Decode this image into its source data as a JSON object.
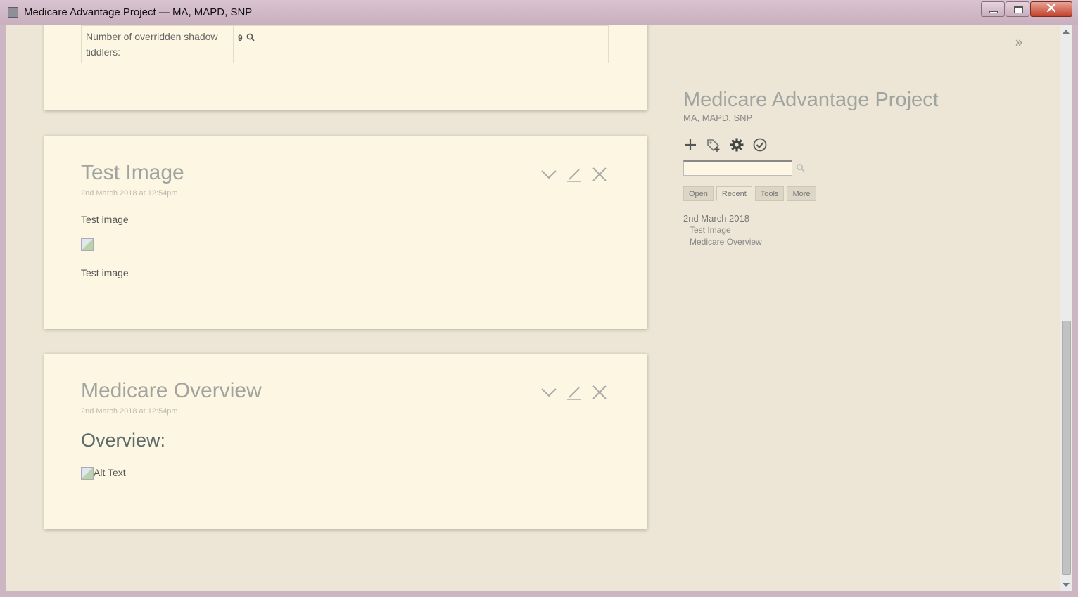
{
  "window": {
    "title": "Medicare Advantage Project — MA, MAPD, SNP",
    "minimize_glyph": "",
    "close_glyph": "✕"
  },
  "tiddlers": [
    {
      "table": {
        "key": "Number of overridden shadow tiddlers:",
        "value": "9"
      }
    },
    {
      "title": "Test Image",
      "subtitle": "2nd March 2018 at 12:54pm",
      "body_text_1": "Test image",
      "body_text_2": "Test image"
    },
    {
      "title": "Medicare Overview",
      "subtitle": "2nd March 2018 at 12:54pm",
      "heading": "Overview:",
      "image_alt": "Alt Text"
    }
  ],
  "sidebar": {
    "toggle_glyph": "»",
    "title": "Medicare Advantage Project",
    "subtitle": "MA, MAPD, SNP",
    "search": {
      "value": "",
      "placeholder": ""
    },
    "tabs": [
      {
        "label": "Open",
        "active": false
      },
      {
        "label": "Recent",
        "active": true
      },
      {
        "label": "Tools",
        "active": false
      },
      {
        "label": "More",
        "active": false
      }
    ],
    "recent": {
      "date": "2nd March 2018",
      "items": [
        "Test Image",
        "Medicare Overview"
      ]
    }
  },
  "colors": {
    "background": "#ede6d6",
    "tiddler_bg": "#fdf6e3",
    "title_text": "#a0a4a0"
  }
}
